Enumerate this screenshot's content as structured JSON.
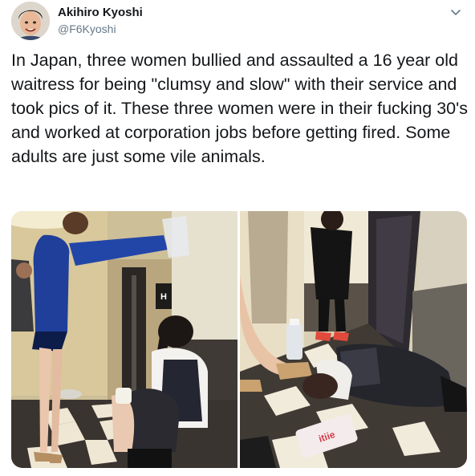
{
  "tweet": {
    "author": {
      "name": "Akihiro Kyoshi",
      "handle": "@F6Kyoshi"
    },
    "text": "In Japan, three women bullied and assaulted a 16 year old waitress for being \"clumsy and slow\" with their service and took pics of it. These three women were in their fucking 30's and worked at corporation jobs before getting fired. Some adults are just some vile animals.",
    "menu_icon": "chevron-down-icon"
  },
  "media": {
    "photos": [
      {
        "sign_text": "H"
      },
      {
        "bag_text": "itiie"
      }
    ]
  },
  "colors": {
    "text": "#14171a",
    "secondary": "#657786",
    "background": "#ffffff"
  }
}
